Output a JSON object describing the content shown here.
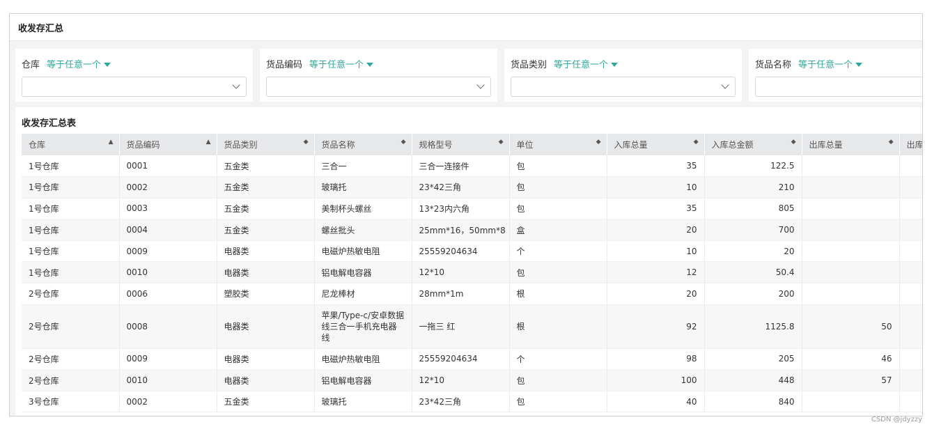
{
  "page": {
    "title": "收发存汇总",
    "watermark": "CSDN @jdyzzy"
  },
  "filters": [
    {
      "label": "仓库",
      "mode": "等于任意一个"
    },
    {
      "label": "货品编码",
      "mode": "等于任意一个"
    },
    {
      "label": "货品类别",
      "mode": "等于任意一个"
    },
    {
      "label": "货品名称",
      "mode": "等于任意一个"
    }
  ],
  "table": {
    "title": "收发存汇总表",
    "columns": [
      {
        "label": "仓库",
        "sort": "▲"
      },
      {
        "label": "货品编码",
        "sort": "▲"
      },
      {
        "label": "货品类别",
        "sort": "◆"
      },
      {
        "label": "货品名称",
        "sort": "◆"
      },
      {
        "label": "规格型号",
        "sort": "◆"
      },
      {
        "label": "单位",
        "sort": "◆"
      },
      {
        "label": "入库总量",
        "sort": "◆"
      },
      {
        "label": "入库总金额",
        "sort": "◆"
      },
      {
        "label": "出库总量",
        "sort": "◆"
      },
      {
        "label": "出库",
        "sort": ""
      }
    ],
    "rows": [
      [
        "1号仓库",
        "0001",
        "五金类",
        "三合一",
        "三合一连接件",
        "包",
        "35",
        "122.5",
        "",
        ""
      ],
      [
        "1号仓库",
        "0002",
        "五金类",
        "玻璃托",
        "23*42三角",
        "包",
        "10",
        "210",
        "",
        ""
      ],
      [
        "1号仓库",
        "0003",
        "五金类",
        "美制杯头螺丝",
        "13*23内六角",
        "包",
        "35",
        "805",
        "",
        ""
      ],
      [
        "1号仓库",
        "0004",
        "五金类",
        "螺丝批头",
        "25mm*16，50mm*8",
        "盒",
        "20",
        "700",
        "",
        ""
      ],
      [
        "1号仓库",
        "0009",
        "电器类",
        "电磁炉热敏电阻",
        "25559204634",
        "个",
        "10",
        "20",
        "",
        ""
      ],
      [
        "1号仓库",
        "0010",
        "电器类",
        "铝电解电容器",
        "12*10",
        "包",
        "12",
        "50.4",
        "",
        ""
      ],
      [
        "2号仓库",
        "0006",
        "塑胶类",
        "尼龙棒材",
        "28mm*1m",
        "根",
        "20",
        "200",
        "",
        ""
      ],
      [
        "2号仓库",
        "0008",
        "电器类",
        "苹果/Type-c/安卓数据线三合一手机充电器线",
        "一拖三 红",
        "根",
        "92",
        "1125.8",
        "50",
        ""
      ],
      [
        "2号仓库",
        "0009",
        "电器类",
        "电磁炉热敏电阻",
        "25559204634",
        "个",
        "98",
        "205",
        "46",
        ""
      ],
      [
        "2号仓库",
        "0010",
        "电器类",
        "铝电解电容器",
        "12*10",
        "包",
        "100",
        "448",
        "57",
        ""
      ],
      [
        "3号仓库",
        "0002",
        "五金类",
        "玻璃托",
        "23*42三角",
        "包",
        "40",
        "840",
        "",
        ""
      ]
    ]
  }
}
